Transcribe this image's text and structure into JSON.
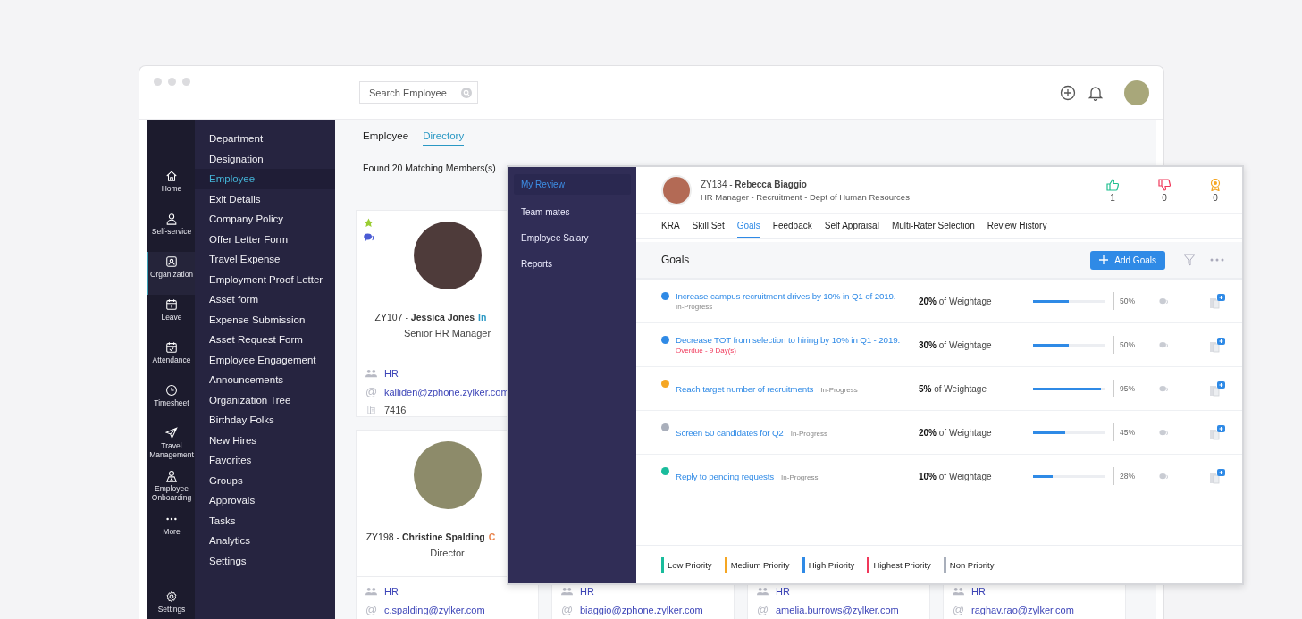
{
  "search": {
    "placeholder": "Search Employee"
  },
  "rail": [
    {
      "label": "Home",
      "selected": false
    },
    {
      "label": "Self-service",
      "selected": false
    },
    {
      "label": "Organization",
      "selected": true
    },
    {
      "label": "Leave",
      "selected": false
    },
    {
      "label": "Attendance",
      "selected": false
    },
    {
      "label": "Timesheet",
      "selected": false
    },
    {
      "label": "Travel Management",
      "selected": false
    },
    {
      "label": "Employee Onboarding",
      "selected": false
    },
    {
      "label": "More",
      "selected": false
    }
  ],
  "rail_footer": {
    "label": "Settings"
  },
  "menu": [
    {
      "label": "Department",
      "selected": false
    },
    {
      "label": "Designation",
      "selected": false
    },
    {
      "label": "Employee",
      "selected": true
    },
    {
      "label": "Exit Details",
      "selected": false
    },
    {
      "label": "Company Policy",
      "selected": false
    },
    {
      "label": "Offer Letter Form",
      "selected": false
    },
    {
      "label": "Travel Expense",
      "selected": false
    },
    {
      "label": "Employment Proof Letter",
      "selected": false
    },
    {
      "label": "Asset form",
      "selected": false
    },
    {
      "label": "Expense Submission",
      "selected": false
    },
    {
      "label": "Asset Request Form",
      "selected": false
    },
    {
      "label": "Employee Engagement",
      "selected": false
    },
    {
      "label": "Announcements",
      "selected": false
    },
    {
      "label": "Organization Tree",
      "selected": false
    },
    {
      "label": "Birthday Folks",
      "selected": false
    },
    {
      "label": "New Hires",
      "selected": false
    },
    {
      "label": "Favorites",
      "selected": false
    },
    {
      "label": "Groups",
      "selected": false
    },
    {
      "label": "Approvals",
      "selected": false
    },
    {
      "label": "Tasks",
      "selected": false
    },
    {
      "label": "Analytics",
      "selected": false
    },
    {
      "label": "Settings",
      "selected": false
    }
  ],
  "content": {
    "tabs": [
      {
        "label": "Employee",
        "selected": false
      },
      {
        "label": "Directory",
        "selected": true
      }
    ],
    "result_count": "Found 20 Matching Members(s)",
    "cards": [
      {
        "favorite": true,
        "chat": true,
        "id_name": "ZY107 - **Jessica Jones**",
        "status": {
          "text": "In",
          "color": "#2a98c4"
        },
        "title": "Senior HR Manager",
        "dept": "HR",
        "email_icon": "@",
        "email": "kalliden@zphone.zylker.com",
        "extension": "7416"
      },
      {
        "favorite": false,
        "chat": false,
        "id_name": "ZY198 - **Christine Spalding**",
        "status": {
          "text": "C",
          "color": "#e8824a"
        },
        "title": "Director",
        "dept": "HR",
        "email_icon": "@",
        "email": "c.spalding@zylker.com"
      }
    ],
    "partial_cards": [
      {
        "dept": "HR",
        "email_icon": "@",
        "email": "biaggio@zphone.zylker.com"
      },
      {
        "dept": "HR",
        "email_icon": "@",
        "email": "amelia.burrows@zylker.com"
      },
      {
        "dept": "HR",
        "email_icon": "@",
        "email": "raghav.rao@zylker.com"
      }
    ]
  },
  "review_panel": {
    "nav": [
      {
        "label": "My Review",
        "selected": true
      },
      {
        "label": "Team mates",
        "selected": false
      },
      {
        "label": "Employee Salary",
        "selected": false
      },
      {
        "label": "Reports",
        "selected": false
      }
    ],
    "employee": {
      "id_name": "ZY134 - **Rebecca Biaggio**",
      "subtitle": "HR Manager - Recruitment - Dept of Human Resources"
    },
    "counters": [
      {
        "kind": "like",
        "value": "1"
      },
      {
        "kind": "dislike",
        "value": "0"
      },
      {
        "kind": "award",
        "value": "0"
      }
    ],
    "tabs": [
      {
        "label": "KRA",
        "selected": false
      },
      {
        "label": "Skill Set",
        "selected": false
      },
      {
        "label": "Goals",
        "selected": true
      },
      {
        "label": "Feedback",
        "selected": false
      },
      {
        "label": "Self Appraisal",
        "selected": false
      },
      {
        "label": "Multi-Rater Selection",
        "selected": false
      },
      {
        "label": "Review History",
        "selected": false
      }
    ],
    "section_title": "Goals",
    "add_button": "Add Goals",
    "goals": [
      {
        "color": "#2f8ae6",
        "title": "Increase campus recruitment drives by 10% in Q1 of 2019.",
        "status": "In-Progress",
        "overdue": false,
        "weight": "20%",
        "weight_label": "of Weightage",
        "level": 0.5,
        "progress": "50%"
      },
      {
        "color": "#2f8ae6",
        "title": "Decrease TOT from selection to hiring by 10% in Q1 - 2019.",
        "status": "Overdue - 9 Day(s)",
        "overdue": true,
        "weight": "30%",
        "weight_label": "of Weightage",
        "level": 0.5,
        "progress": "50%"
      },
      {
        "color": "#f5a623",
        "title": "Reach target number of recruitments",
        "status": "In-Progress",
        "overdue": false,
        "weight": "5%",
        "weight_label": "of Weightage",
        "level": 0.95,
        "progress": "95%"
      },
      {
        "color": "#a9afbb",
        "title": "Screen 50 candidates for Q2",
        "status": "In-Progress",
        "overdue": false,
        "weight": "20%",
        "weight_label": "of Weightage",
        "level": 0.45,
        "progress": "45%"
      },
      {
        "color": "#1abc9c",
        "title": "Reply to pending requests",
        "status": "In-Progress",
        "overdue": false,
        "weight": "10%",
        "weight_label": "of Weightage",
        "level": 0.28,
        "progress": "28%"
      }
    ],
    "legend": [
      {
        "label": "Low Priority",
        "color": "#1abc9c"
      },
      {
        "label": "Medium Priority",
        "color": "#f5a623"
      },
      {
        "label": "High Priority",
        "color": "#2f8ae6"
      },
      {
        "label": "Highest Priority",
        "color": "#f0385a"
      },
      {
        "label": "Non Priority",
        "color": "#a9afbb"
      }
    ]
  }
}
